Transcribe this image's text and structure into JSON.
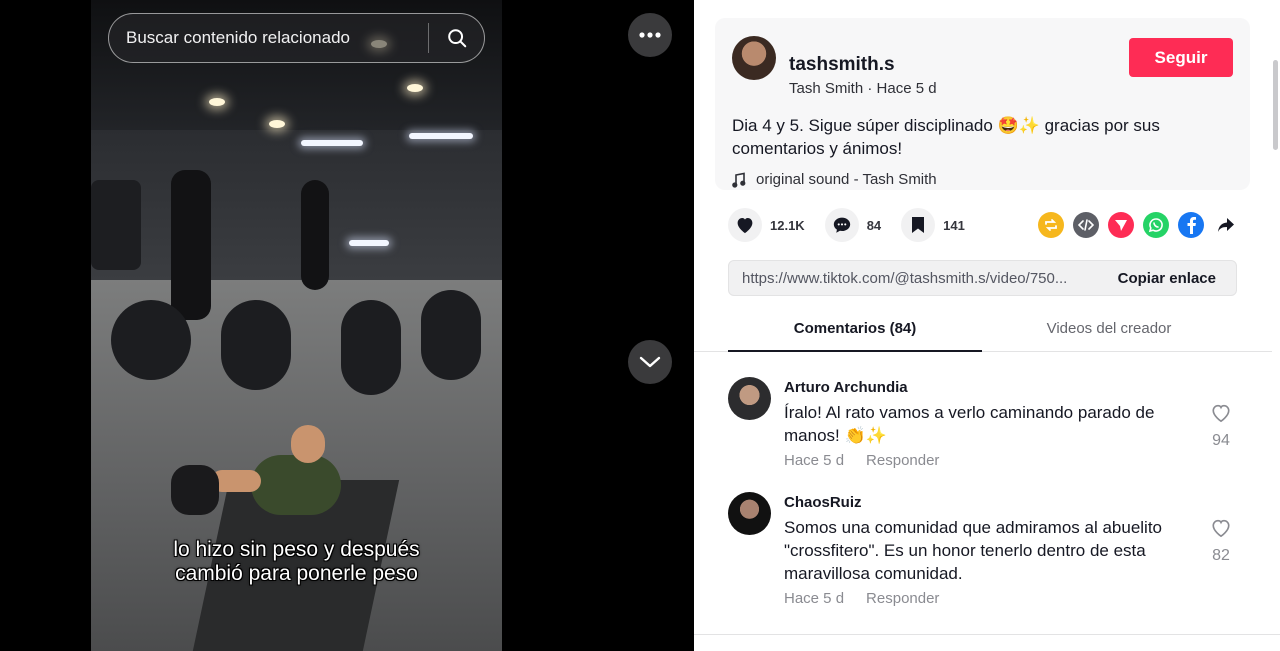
{
  "video": {
    "search_placeholder": "Buscar contenido relacionado",
    "caption_line1": "lo hizo sin peso y después",
    "caption_line2": "cambió para ponerle peso"
  },
  "author": {
    "username": "tashsmith.s",
    "subline": "Tash Smith · Hace 5 d",
    "follow_label": "Seguir",
    "description": "Dia 4 y 5. Sigue súper disciplinado 🤩✨ gracias por sus comentarios y ánimos!",
    "sound": "original sound - Tash Smith"
  },
  "stats": {
    "likes": "12.1K",
    "comments": "84",
    "saves": "141"
  },
  "link": {
    "url": "https://www.tiktok.com/@tashsmith.s/video/750...",
    "copy_label": "Copiar enlace"
  },
  "tabs": [
    {
      "label": "Comentarios (84)"
    },
    {
      "label": "Videos del creador"
    }
  ],
  "comments": [
    {
      "user": "Arturo Archundia",
      "text": "Íralo! Al rato vamos a verlo caminando parado de manos! 👏✨",
      "time": "Hace 5 d",
      "reply": "Responder",
      "likes": "94"
    },
    {
      "user": "ChaosRuiz",
      "text": "Somos una comunidad que admiramos al abuelito \"crossfitero\". Es un honor tenerlo dentro de esta maravillosa comunidad.",
      "time": "Hace 5 d",
      "reply": "Responder",
      "likes": "82"
    }
  ],
  "colors": {
    "accent": "#fe2c55",
    "text": "#161823",
    "muted": "#8a8b91"
  }
}
